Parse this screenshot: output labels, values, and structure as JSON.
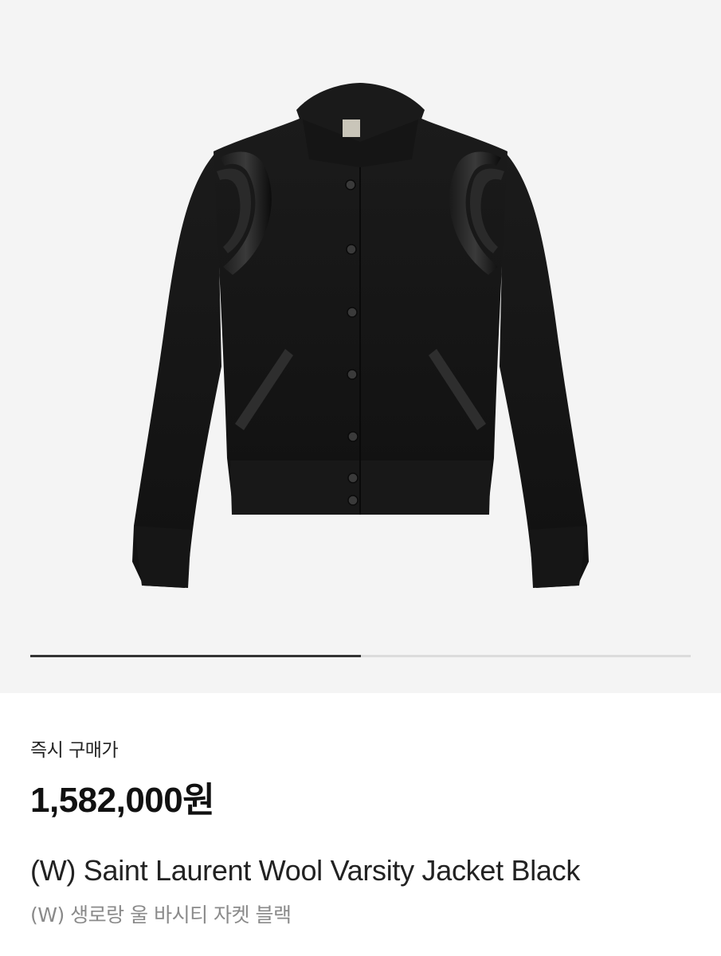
{
  "gallery": {
    "image_alt": "(W) Saint Laurent Wool Varsity Jacket Black",
    "progress": 0.5
  },
  "product": {
    "price_label": "즉시 구매가",
    "price": "1,582,000원",
    "title_en": "(W) Saint Laurent Wool Varsity Jacket Black",
    "title_ko": "(W) 생로랑 울 바시티 자켓 블랙"
  },
  "colors": {
    "gallery_bg": "#f4f4f4",
    "progress_fill": "#333333",
    "progress_track": "#dcdcdc",
    "jacket": "#141414",
    "leather": "#0a0a0a"
  }
}
